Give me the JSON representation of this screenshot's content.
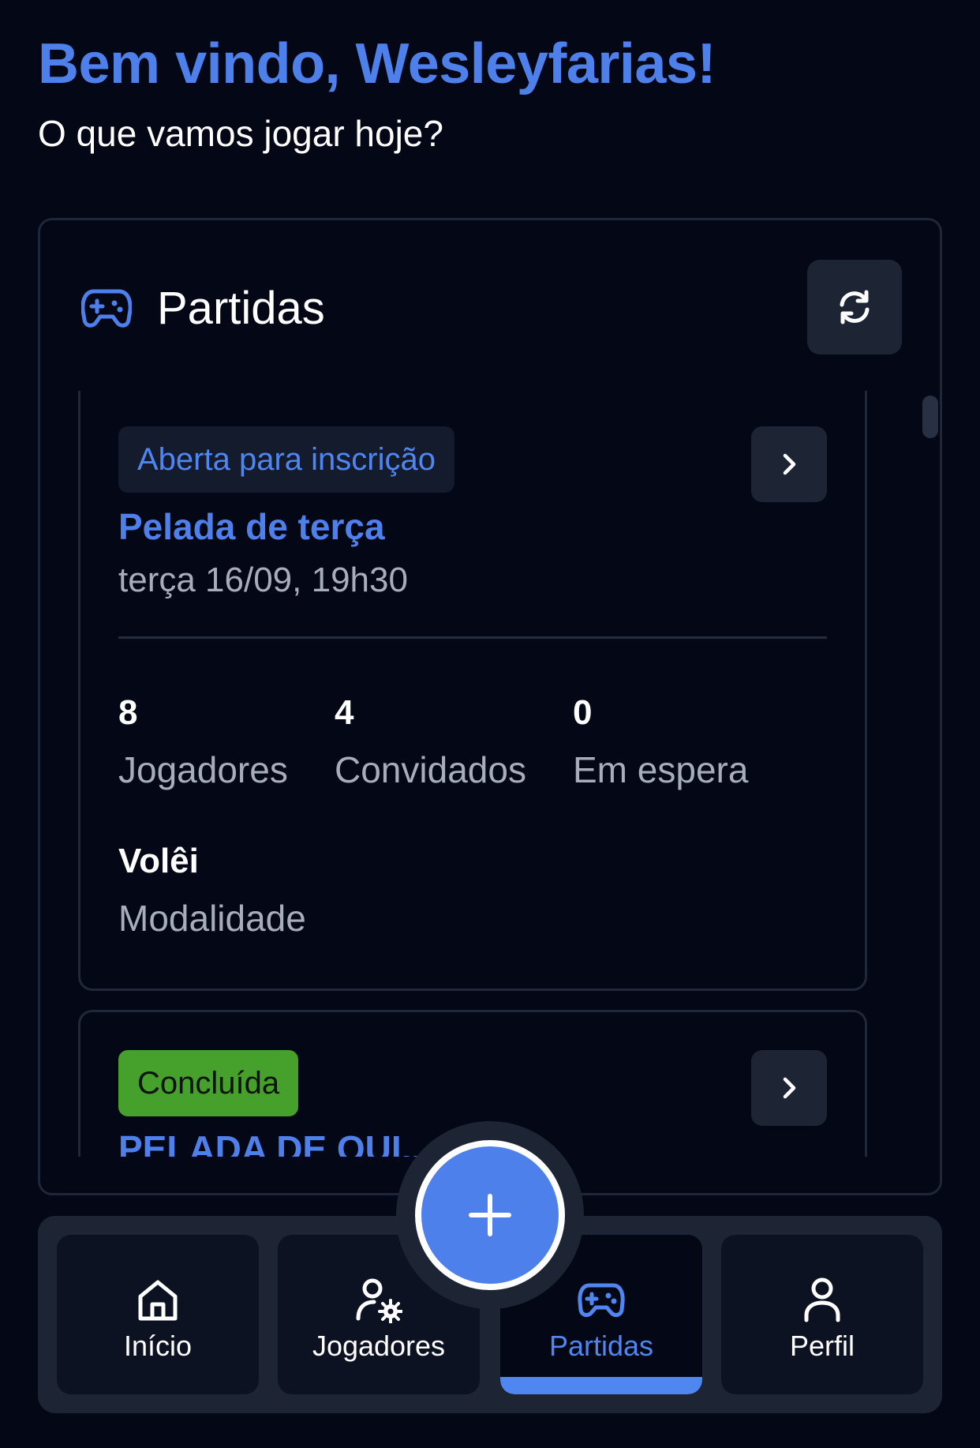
{
  "header": {
    "title": "Bem vindo, Wesleyfarias!",
    "subtitle": "O que vamos jogar hoje?"
  },
  "panel": {
    "title": "Partidas",
    "icon": "gamepad-icon",
    "refresh_icon": "refresh-icon"
  },
  "matches": [
    {
      "status": "Aberta para inscrição",
      "name": "Pelada de terça",
      "date": "terça 16/09, 19h30",
      "stats": [
        {
          "value": "8",
          "label": "Jogadores"
        },
        {
          "value": "4",
          "label": "Convidados"
        },
        {
          "value": "0",
          "label": "Em espera"
        }
      ],
      "mode": {
        "value": "Volêi",
        "label": "Modalidade"
      }
    },
    {
      "status": "Concluída",
      "name": "PELADA DE QUI..."
    }
  ],
  "fab": {
    "icon": "plus-icon"
  },
  "nav": {
    "items": [
      {
        "label": "Início",
        "icon": "home-icon"
      },
      {
        "label": "Jogadores",
        "icon": "user-settings-icon"
      },
      {
        "label": "Partidas",
        "icon": "gamepad-icon"
      },
      {
        "label": "Perfil",
        "icon": "user-icon"
      }
    ],
    "active_index": 2
  },
  "colors": {
    "background": "#040816",
    "accent": "#4e80ec",
    "open_badge": "#141b2d",
    "done_badge": "#46a02c",
    "muted_text": "#a8adbb"
  }
}
